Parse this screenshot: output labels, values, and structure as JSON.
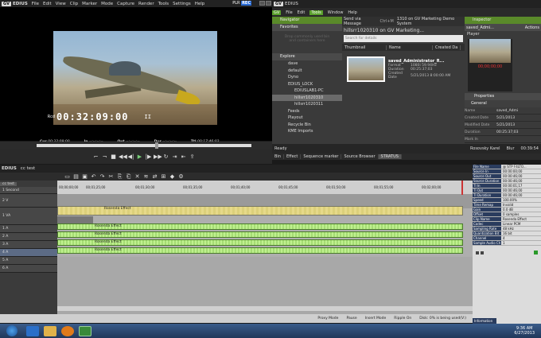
{
  "title_bar": {
    "logo": "GV",
    "app": "EDIUS",
    "menu": [
      "File",
      "Edit",
      "View",
      "Clip",
      "Marker",
      "Mode",
      "Capture",
      "Render",
      "Tools",
      "Settings",
      "Help"
    ],
    "plr": "PLR",
    "rec": "REC"
  },
  "player": {
    "tc_label": "Rcd",
    "timecode": "00:32:09:00",
    "play_state": "II",
    "in_label": "Cur",
    "in_value": "00:32:09;00",
    "in2_label": "In",
    "in2_value": "--:--:--;--",
    "out_label": "Out",
    "out_value": "--:--:--;--",
    "dur_label": "Dur",
    "dur_value": "--:--:--;--",
    "ttl_label": "Ttl",
    "ttl_value": "00:17:46;03"
  },
  "transport": {
    "buttons": [
      "set-in",
      "set-out",
      "stop",
      "rewind",
      "step-back",
      "play",
      "step-fwd",
      "fast-fwd",
      "loop",
      "insert",
      "overwrite",
      "export"
    ]
  },
  "right_title": {
    "app": "EDIUS"
  },
  "right_menu": [
    "File",
    "Edit",
    "Tools",
    "Window",
    "Help"
  ],
  "right_menu_active": "Tools",
  "navigator": {
    "title": "Navigator",
    "favorites": "Favorites",
    "fav_hint_1": "Drop commonly used bin",
    "fav_hint_2": "and containers here",
    "explore": "Explore",
    "tree": [
      "dave",
      "default",
      "Dyno",
      "EDIUS_LOCK",
      "EDIUSLAB1-PC",
      "hillsrr1020310",
      "hillsrr1020311",
      "Feeds",
      "Playout",
      "Recycle Bin",
      "KME Imports"
    ],
    "selected": "hillsrr1020310"
  },
  "bin": {
    "send_via": "Send via Message",
    "shortcut": "Ctrl+M",
    "path": "1310 on GV Marketing Demo System",
    "path2": "hillsrr1020310 on GV Marketing...",
    "search_placeholder": "Search for details",
    "col_thumb": "Thumbnail",
    "col_name": "Name",
    "col_created": "Created Da",
    "clip_name": "saved_Administrator_R...",
    "format_label": "Format",
    "format_value": "1080i 59.94Hz",
    "duration_label": "Duration",
    "duration_value": "00:25:37;03",
    "created_label": "Created Date",
    "created_value": "5/21/2013 8:00:00 AM"
  },
  "inspector": {
    "title": "Inspector",
    "clip": "saved_Admi...",
    "actions": "Actions",
    "player": "Player",
    "mini_tc": "00;00;00;00",
    "properties": "Properties",
    "general": "General",
    "rows": [
      [
        "Name",
        "saved_Admi"
      ],
      [
        "Created Date",
        "5/21/2013"
      ],
      [
        "Modified Date",
        "5/21/2013"
      ],
      [
        "Duration",
        "00:25:37;03"
      ],
      [
        "Mark In",
        ""
      ]
    ]
  },
  "status_bar": {
    "ready": "Ready",
    "user": "Rosovsky Karel",
    "item1": "Blur",
    "time": "00:39:54"
  },
  "tabs": [
    "Bin",
    "Effect",
    "Sequence marker",
    "Source Browser",
    "STRATUS"
  ],
  "timeline": {
    "app": "EDIUS",
    "project": "cc test",
    "sequence": "cc test",
    "zoom": "1 Second",
    "ticks": [
      "00;00;00;00",
      "00;01;25;00",
      "00;01;30;00",
      "00;01;35;00",
      "00;01;40;00",
      "00;01;45;00",
      "00;01;50;00",
      "00;01;55;00",
      "00;02;00;00",
      "00;02;05;00"
    ],
    "tracks": [
      "2 V",
      "1 VA",
      "1 A",
      "2 A",
      "3 A",
      "4 A",
      "5 A",
      "6 A"
    ],
    "v_clip_label": "Rosenda Effect",
    "a_clip_label": "Rosenda Effect"
  },
  "clip_props": {
    "rows": [
      [
        "File Name",
        "@ STP F4LTO..."
      ],
      [
        "Source In",
        "00:00:00;00"
      ],
      [
        "Source Out",
        "00:00:46;00"
      ],
      [
        "Source Duration",
        "00:00:46;00"
      ],
      [
        "Tl In",
        "00:00:01;17"
      ],
      [
        "Tl Out",
        "00:00:46;00"
      ],
      [
        "Tl Duration",
        "00:00:46;00"
      ],
      [
        "Speed",
        "100.00%"
      ],
      [
        "Time Remap",
        "Invalid"
      ],
      [
        "Gain",
        "0.0 dB"
      ],
      [
        "Offset",
        "0 samples"
      ],
      [
        "Clip Name",
        "Rosenda Effect"
      ],
      [
        "Codec",
        "Linear PCM"
      ],
      [
        "Sampling Rate",
        "48 kHz"
      ],
      [
        "Quantization Bit",
        "16 bit"
      ],
      [
        "Channel",
        "4"
      ],
      [
        "Sample Audio Ch",
        "1"
      ]
    ],
    "info_tab": "Information"
  },
  "tl_status": {
    "proxy": "Proxy Mode",
    "pause": "Pause",
    "insert": "Insert Mode",
    "ripple": "Ripple On",
    "disk": "Disk: 0% is being used(V:)"
  },
  "taskbar": {
    "time": "9:36 AM",
    "date": "6/27/2013"
  }
}
